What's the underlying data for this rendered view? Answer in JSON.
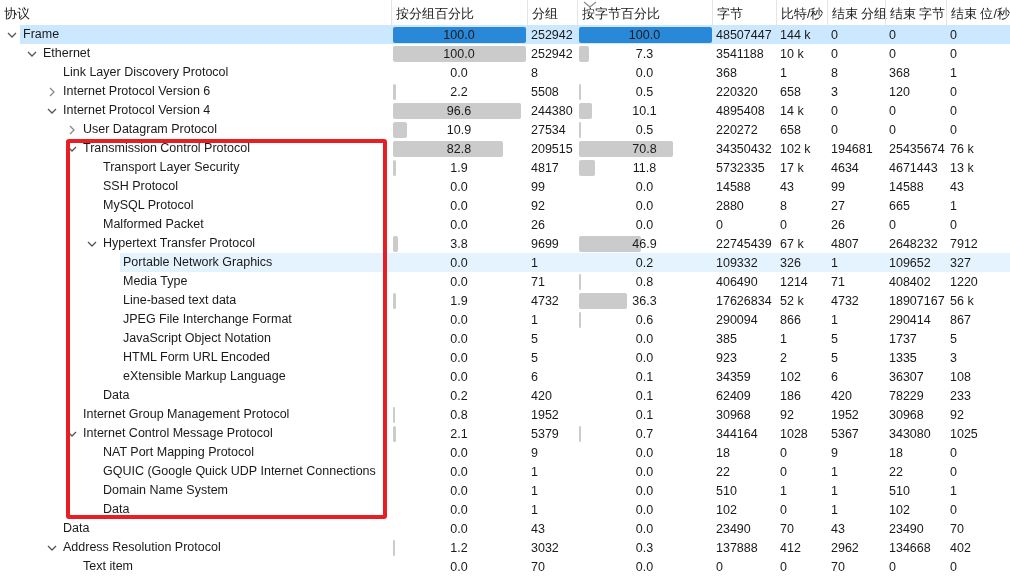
{
  "columns": [
    "协议",
    "按分组百分比",
    "分组",
    "按字节百分比",
    "字节",
    "比特/秒",
    "结束 分组",
    "结束 字节",
    "结束 位/秒"
  ],
  "rows": [
    {
      "protocol": "Frame",
      "expanded": true,
      "selected": true,
      "highlighted": false,
      "pkt_pct": "100.0",
      "packets": "252942",
      "byte_pct": "100.0",
      "bytes": "48507447",
      "bits_s": "144 k",
      "end_packets": "0",
      "end_bytes": "0",
      "end_bits_s": "0",
      "children": [
        {
          "protocol": "Ethernet",
          "expanded": true,
          "selected": false,
          "highlighted": false,
          "pkt_pct": "100.0",
          "packets": "252942",
          "byte_pct": "7.3",
          "bytes": "3541188",
          "bits_s": "10 k",
          "end_packets": "0",
          "end_bytes": "0",
          "end_bits_s": "0",
          "children": [
            {
              "protocol": "Link Layer Discovery Protocol",
              "selected": false,
              "highlighted": false,
              "pkt_pct": "0.0",
              "packets": "8",
              "byte_pct": "0.0",
              "bytes": "368",
              "bits_s": "1",
              "end_packets": "8",
              "end_bytes": "368",
              "end_bits_s": "1"
            },
            {
              "protocol": "Internet Protocol Version 6",
              "expanded": false,
              "selected": false,
              "highlighted": false,
              "pkt_pct": "2.2",
              "packets": "5508",
              "byte_pct": "0.5",
              "bytes": "220320",
              "bits_s": "658",
              "end_packets": "3",
              "end_bytes": "120",
              "end_bits_s": "0"
            },
            {
              "protocol": "Internet Protocol Version 4",
              "expanded": true,
              "selected": false,
              "highlighted": false,
              "pkt_pct": "96.6",
              "packets": "244380",
              "byte_pct": "10.1",
              "bytes": "4895408",
              "bits_s": "14 k",
              "end_packets": "0",
              "end_bytes": "0",
              "end_bits_s": "0",
              "children": [
                {
                  "protocol": "User Datagram Protocol",
                  "expanded": false,
                  "selected": false,
                  "highlighted": false,
                  "pkt_pct": "10.9",
                  "packets": "27534",
                  "byte_pct": "0.5",
                  "bytes": "220272",
                  "bits_s": "658",
                  "end_packets": "0",
                  "end_bytes": "0",
                  "end_bits_s": "0"
                },
                {
                  "protocol": "Transmission Control Protocol",
                  "expanded": true,
                  "selected": false,
                  "highlighted": false,
                  "pkt_pct": "82.8",
                  "packets": "209515",
                  "byte_pct": "70.8",
                  "bytes": "34350432",
                  "bits_s": "102 k",
                  "end_packets": "194681",
                  "end_bytes": "25435674",
                  "end_bits_s": "76 k",
                  "children": [
                    {
                      "protocol": "Transport Layer Security",
                      "selected": false,
                      "highlighted": false,
                      "pkt_pct": "1.9",
                      "packets": "4817",
                      "byte_pct": "11.8",
                      "bytes": "5732335",
                      "bits_s": "17 k",
                      "end_packets": "4634",
                      "end_bytes": "4671443",
                      "end_bits_s": "13 k"
                    },
                    {
                      "protocol": "SSH Protocol",
                      "selected": false,
                      "highlighted": false,
                      "pkt_pct": "0.0",
                      "packets": "99",
                      "byte_pct": "0.0",
                      "bytes": "14588",
                      "bits_s": "43",
                      "end_packets": "99",
                      "end_bytes": "14588",
                      "end_bits_s": "43"
                    },
                    {
                      "protocol": "MySQL Protocol",
                      "selected": false,
                      "highlighted": false,
                      "pkt_pct": "0.0",
                      "packets": "92",
                      "byte_pct": "0.0",
                      "bytes": "2880",
                      "bits_s": "8",
                      "end_packets": "27",
                      "end_bytes": "665",
                      "end_bits_s": "1"
                    },
                    {
                      "protocol": "Malformed Packet",
                      "selected": false,
                      "highlighted": false,
                      "pkt_pct": "0.0",
                      "packets": "26",
                      "byte_pct": "0.0",
                      "bytes": "0",
                      "bits_s": "0",
                      "end_packets": "26",
                      "end_bytes": "0",
                      "end_bits_s": "0"
                    },
                    {
                      "protocol": "Hypertext Transfer Protocol",
                      "expanded": true,
                      "selected": false,
                      "highlighted": false,
                      "pkt_pct": "3.8",
                      "packets": "9699",
                      "byte_pct": "46.9",
                      "bytes": "22745439",
                      "bits_s": "67 k",
                      "end_packets": "4807",
                      "end_bytes": "2648232",
                      "end_bits_s": "7912",
                      "children": [
                        {
                          "protocol": "Portable Network Graphics",
                          "selected": false,
                          "highlighted": true,
                          "pkt_pct": "0.0",
                          "packets": "1",
                          "byte_pct": "0.2",
                          "bytes": "109332",
                          "bits_s": "326",
                          "end_packets": "1",
                          "end_bytes": "109652",
                          "end_bits_s": "327"
                        },
                        {
                          "protocol": "Media Type",
                          "selected": false,
                          "highlighted": false,
                          "pkt_pct": "0.0",
                          "packets": "71",
                          "byte_pct": "0.8",
                          "bytes": "406490",
                          "bits_s": "1214",
                          "end_packets": "71",
                          "end_bytes": "408402",
                          "end_bits_s": "1220"
                        },
                        {
                          "protocol": "Line-based text data",
                          "selected": false,
                          "highlighted": false,
                          "pkt_pct": "1.9",
                          "packets": "4732",
                          "byte_pct": "36.3",
                          "bytes": "17626834",
                          "bits_s": "52 k",
                          "end_packets": "4732",
                          "end_bytes": "18907167",
                          "end_bits_s": "56 k"
                        },
                        {
                          "protocol": "JPEG File Interchange Format",
                          "selected": false,
                          "highlighted": false,
                          "pkt_pct": "0.0",
                          "packets": "1",
                          "byte_pct": "0.6",
                          "bytes": "290094",
                          "bits_s": "866",
                          "end_packets": "1",
                          "end_bytes": "290414",
                          "end_bits_s": "867"
                        },
                        {
                          "protocol": "JavaScript Object Notation",
                          "selected": false,
                          "highlighted": false,
                          "pkt_pct": "0.0",
                          "packets": "5",
                          "byte_pct": "0.0",
                          "bytes": "385",
                          "bits_s": "1",
                          "end_packets": "5",
                          "end_bytes": "1737",
                          "end_bits_s": "5"
                        },
                        {
                          "protocol": "HTML Form URL Encoded",
                          "selected": false,
                          "highlighted": false,
                          "pkt_pct": "0.0",
                          "packets": "5",
                          "byte_pct": "0.0",
                          "bytes": "923",
                          "bits_s": "2",
                          "end_packets": "5",
                          "end_bytes": "1335",
                          "end_bits_s": "3"
                        },
                        {
                          "protocol": "eXtensible Markup Language",
                          "selected": false,
                          "highlighted": false,
                          "pkt_pct": "0.0",
                          "packets": "6",
                          "byte_pct": "0.1",
                          "bytes": "34359",
                          "bits_s": "102",
                          "end_packets": "6",
                          "end_bytes": "36307",
                          "end_bits_s": "108"
                        }
                      ]
                    },
                    {
                      "protocol": "Data",
                      "selected": false,
                      "highlighted": false,
                      "pkt_pct": "0.2",
                      "packets": "420",
                      "byte_pct": "0.1",
                      "bytes": "62409",
                      "bits_s": "186",
                      "end_packets": "420",
                      "end_bytes": "78229",
                      "end_bits_s": "233"
                    }
                  ]
                },
                {
                  "protocol": "Internet Group Management Protocol",
                  "selected": false,
                  "highlighted": false,
                  "pkt_pct": "0.8",
                  "packets": "1952",
                  "byte_pct": "0.1",
                  "bytes": "30968",
                  "bits_s": "92",
                  "end_packets": "1952",
                  "end_bytes": "30968",
                  "end_bits_s": "92"
                },
                {
                  "protocol": "Internet Control Message Protocol",
                  "expanded": true,
                  "selected": false,
                  "highlighted": false,
                  "pkt_pct": "2.1",
                  "packets": "5379",
                  "byte_pct": "0.7",
                  "bytes": "344164",
                  "bits_s": "1028",
                  "end_packets": "5367",
                  "end_bytes": "343080",
                  "end_bits_s": "1025",
                  "children": [
                    {
                      "protocol": "NAT Port Mapping Protocol",
                      "selected": false,
                      "highlighted": false,
                      "pkt_pct": "0.0",
                      "packets": "9",
                      "byte_pct": "0.0",
                      "bytes": "18",
                      "bits_s": "0",
                      "end_packets": "9",
                      "end_bytes": "18",
                      "end_bits_s": "0"
                    },
                    {
                      "protocol": "GQUIC (Google Quick UDP Internet Connections",
                      "selected": false,
                      "highlighted": false,
                      "pkt_pct": "0.0",
                      "packets": "1",
                      "byte_pct": "0.0",
                      "bytes": "22",
                      "bits_s": "0",
                      "end_packets": "1",
                      "end_bytes": "22",
                      "end_bits_s": "0"
                    },
                    {
                      "protocol": "Domain Name System",
                      "selected": false,
                      "highlighted": false,
                      "pkt_pct": "0.0",
                      "packets": "1",
                      "byte_pct": "0.0",
                      "bytes": "510",
                      "bits_s": "1",
                      "end_packets": "1",
                      "end_bytes": "510",
                      "end_bits_s": "1"
                    },
                    {
                      "protocol": "Data",
                      "selected": false,
                      "highlighted": false,
                      "pkt_pct": "0.0",
                      "packets": "1",
                      "byte_pct": "0.0",
                      "bytes": "102",
                      "bits_s": "0",
                      "end_packets": "1",
                      "end_bytes": "102",
                      "end_bits_s": "0"
                    }
                  ]
                }
              ]
            },
            {
              "protocol": "Data",
              "selected": false,
              "highlighted": false,
              "pkt_pct": "0.0",
              "packets": "43",
              "byte_pct": "0.0",
              "bytes": "23490",
              "bits_s": "70",
              "end_packets": "43",
              "end_bytes": "23490",
              "end_bits_s": "70"
            },
            {
              "protocol": "Address Resolution Protocol",
              "expanded": true,
              "selected": false,
              "highlighted": false,
              "pkt_pct": "1.2",
              "packets": "3032",
              "byte_pct": "0.3",
              "bytes": "137888",
              "bits_s": "412",
              "end_packets": "2962",
              "end_bytes": "134668",
              "end_bits_s": "402",
              "children": [
                {
                  "protocol": "Text item",
                  "selected": false,
                  "highlighted": false,
                  "pkt_pct": "0.0",
                  "packets": "70",
                  "byte_pct": "0.0",
                  "bytes": "0",
                  "bits_s": "0",
                  "end_packets": "70",
                  "end_bytes": "0",
                  "end_bits_s": "0"
                }
              ]
            }
          ]
        }
      ]
    }
  ]
}
